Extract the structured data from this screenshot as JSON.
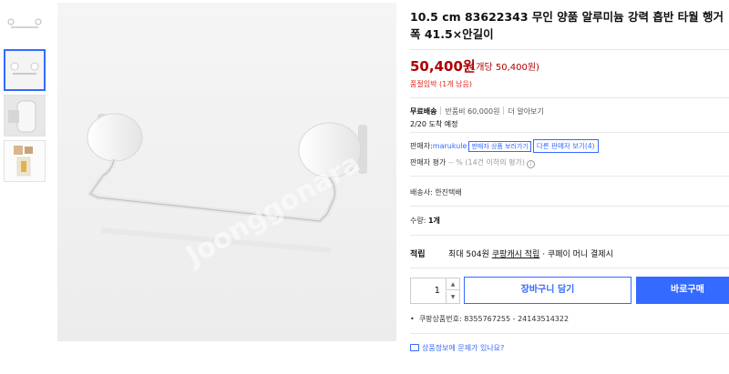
{
  "product": {
    "title": "10.5 cm 83622343 무인 양품 알루미늄 강력 흡반 타월 행거 폭 41.5×안길이",
    "price": "50,400원",
    "unit_price": "(1개당 50,400원)",
    "stock": "품절임박 (1개 남음)"
  },
  "shipping": {
    "free_label": "무료배송",
    "return_fee": "반품비 60,000원",
    "more": "더 알아보기",
    "arrival": "2/20 도착 예정"
  },
  "seller": {
    "label": "판매자:",
    "name": "marukule",
    "other_products": "판매자 상품 보러가기",
    "other_sellers": "다른 판매자 보기(4)",
    "rating_label": "판매자 평가",
    "rating_value": "-- %",
    "rating_note": "(14건 이하의 평가)",
    "info_icon": "i"
  },
  "delivery": {
    "label": "배송사: 한진택배"
  },
  "quantity": {
    "label": "수량:",
    "value": "1개"
  },
  "cash": {
    "label": "적립",
    "text_before": "최대 504원",
    "link": "쿠팡캐시 적립",
    "text_after": "· 쿠페이 머니 결제시"
  },
  "purchase": {
    "qty": "1",
    "cart_label": "장바구니 담기",
    "buy_label": "바로구매"
  },
  "product_no": "쿠팡상품번호: 8355767255 - 24143514322",
  "report_link": "상품정보에 문제가 있나요?",
  "watermark": "Joonggonara",
  "colors": {
    "accent": "#346aff",
    "price": "#ae0000",
    "stock": "#e0261c"
  },
  "icons": [
    "info-icon",
    "chat-icon",
    "chevron-up-icon",
    "chevron-down-icon"
  ]
}
